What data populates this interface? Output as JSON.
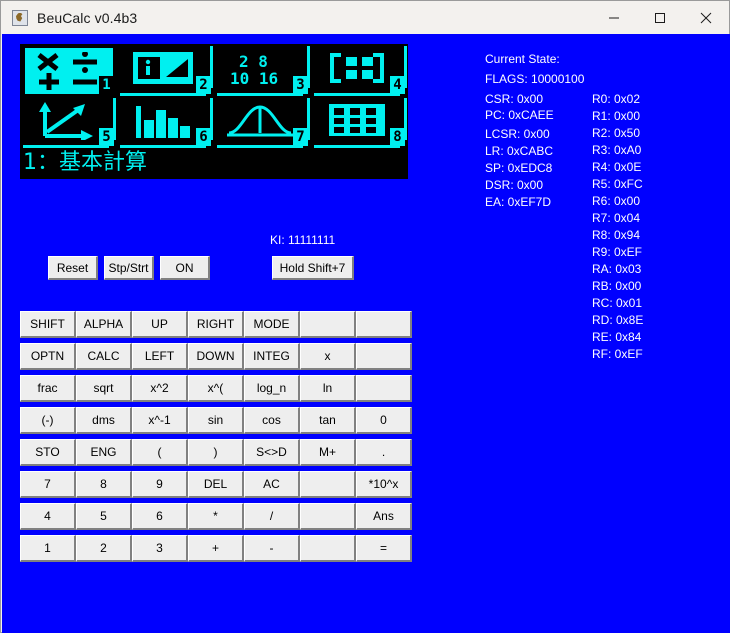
{
  "window": {
    "title": "BeuCalc v0.4b3",
    "app_icon": "java-coffee-cup-icon",
    "minimize": "—",
    "maximize": "□",
    "close": "✕"
  },
  "lcd": {
    "status_line": "1：基本計算",
    "selected_index": 1,
    "icons": [
      {
        "num": "1",
        "name": "basic-calculation-icon",
        "selected": true
      },
      {
        "num": "2",
        "name": "complex-angle-icon",
        "selected": false
      },
      {
        "num": "3",
        "name": "base-n-icon",
        "selected": false
      },
      {
        "num": "4",
        "name": "matrix-icon",
        "selected": false
      },
      {
        "num": "5",
        "name": "vector-icon",
        "selected": false
      },
      {
        "num": "6",
        "name": "statistics-bar-icon",
        "selected": false
      },
      {
        "num": "7",
        "name": "distribution-icon",
        "selected": false
      },
      {
        "num": "8",
        "name": "spreadsheet-icon",
        "selected": false
      }
    ]
  },
  "controls": {
    "ki_label": "KI: 11111111",
    "reset": "Reset",
    "stp_strt": "Stp/Strt",
    "on": "ON",
    "hold_shift": "Hold Shift+7"
  },
  "state": {
    "heading": "Current State:",
    "flags": "FLAGS: 10000100",
    "left_column": [
      "CSR: 0x00",
      "PC: 0xCAEE",
      "LCSR: 0x00",
      "LR: 0xCABC",
      "SP: 0xEDC8",
      "DSR: 0x00",
      "EA: 0xEF7D"
    ],
    "right_column": [
      "R0: 0x02",
      "R1: 0x00",
      "R2: 0x50",
      "R3: 0xA0",
      "R4: 0x0E",
      "R5: 0xFC",
      "R6: 0x00",
      "R7: 0x04",
      "R8: 0x94",
      "R9: 0xEF",
      "RA: 0x03",
      "RB: 0x00",
      "RC: 0x01",
      "RD: 0x8E",
      "RE: 0x84",
      "RF: 0xEF"
    ]
  },
  "keypad": {
    "rows": [
      [
        "SHIFT",
        "ALPHA",
        "UP",
        "RIGHT",
        "MODE",
        "",
        ""
      ],
      [
        "OPTN",
        "CALC",
        "LEFT",
        "DOWN",
        "INTEG",
        "x",
        ""
      ],
      [
        "frac",
        "sqrt",
        "x^2",
        "x^(",
        "log_n",
        "ln",
        ""
      ],
      [
        "(-)",
        "dms",
        "x^-1",
        "sin",
        "cos",
        "tan",
        "0"
      ],
      [
        "STO",
        "ENG",
        "(",
        ")",
        "S<>D",
        "M+",
        "."
      ],
      [
        "7",
        "8",
        "9",
        "DEL",
        "AC",
        "",
        "*10^x"
      ],
      [
        "4",
        "5",
        "6",
        "*",
        "/",
        "",
        "Ans"
      ],
      [
        "1",
        "2",
        "3",
        "+",
        "-",
        "",
        "="
      ]
    ]
  },
  "colors": {
    "client_background": "#0000FF",
    "lcd_background": "#000000",
    "lcd_foreground": "#00F0F0",
    "button_face": "#EEEEEE",
    "text_on_blue": "#FFFFFF"
  }
}
